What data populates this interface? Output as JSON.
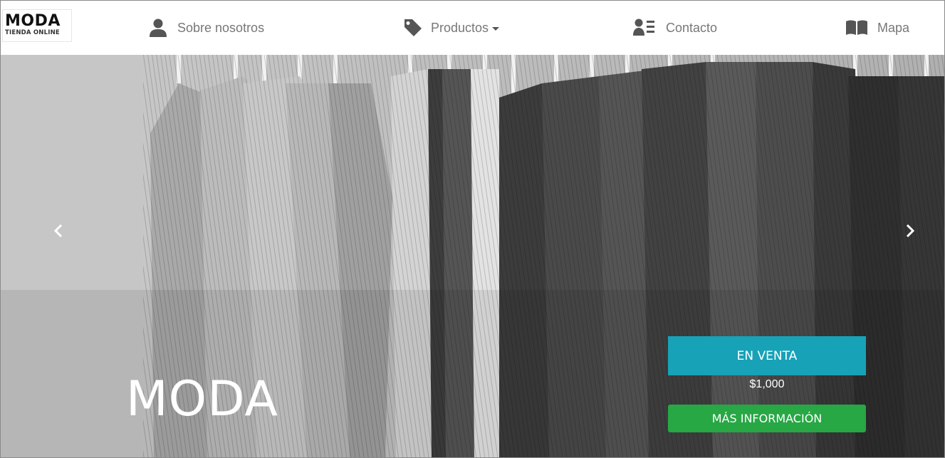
{
  "brand": {
    "name": "MODA",
    "tagline": "TIENDA ONLINE"
  },
  "nav": {
    "about": {
      "label": "Sobre nosotros",
      "icon": "user-icon"
    },
    "products": {
      "label": "Productos",
      "icon": "tag-icon"
    },
    "contact": {
      "label": "Contacto",
      "icon": "address-card-icon"
    },
    "map": {
      "label": "Mapa",
      "icon": "book-map-icon"
    }
  },
  "hero": {
    "title": "MODA",
    "sale_label": "EN VENTA",
    "price": "$1,000",
    "info_button": "MÁS INFORMACIÓN"
  },
  "colors": {
    "sale": "#17a2b8",
    "info": "#28a745",
    "nav_text": "#777777"
  }
}
